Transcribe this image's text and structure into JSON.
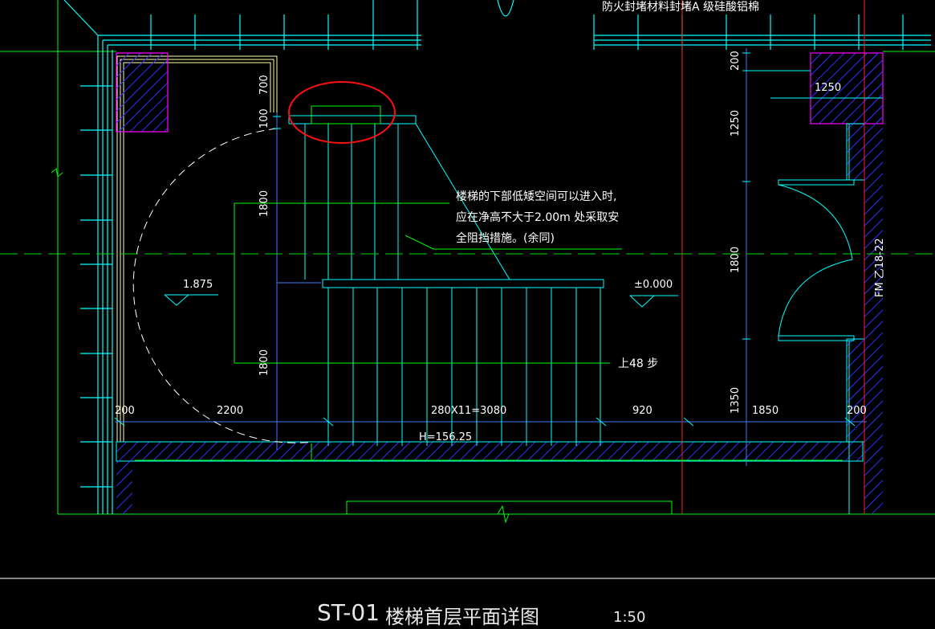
{
  "drawing": {
    "title_code": "ST-01",
    "title_name": "楼梯首层平面详图",
    "scale": "1:50",
    "top_note": "防火封堵材料封堵A 级硅酸铝棉",
    "note_lines": [
      "楼梯的下部低矮空间可以进入时,",
      "应在净高不大于2.00m   处采取安",
      "全阻挡措施。(余同)"
    ],
    "door_tag": "FM 乙18-22",
    "elevation_landing": "1.875",
    "elevation_floor": "±0.000",
    "stair_up": "上48 步",
    "stair_height": "H=156.25",
    "dims_bottom": [
      "200",
      "2200",
      "280X11=3080",
      "920",
      "1850",
      "200"
    ],
    "dims_left_vertical": [
      "700",
      "100",
      "1800",
      "1800"
    ],
    "dims_right_vertical": [
      "200",
      "1250",
      "1800",
      "1350"
    ],
    "dim_column": "1250"
  },
  "colors": {
    "background": "#000000",
    "cyan": "#00ffff",
    "green": "#00ff00",
    "red": "#ff0000",
    "magenta": "#ff00ff",
    "blue": "#0000ff",
    "yellow": "#ffff00",
    "white": "#ffffff"
  }
}
